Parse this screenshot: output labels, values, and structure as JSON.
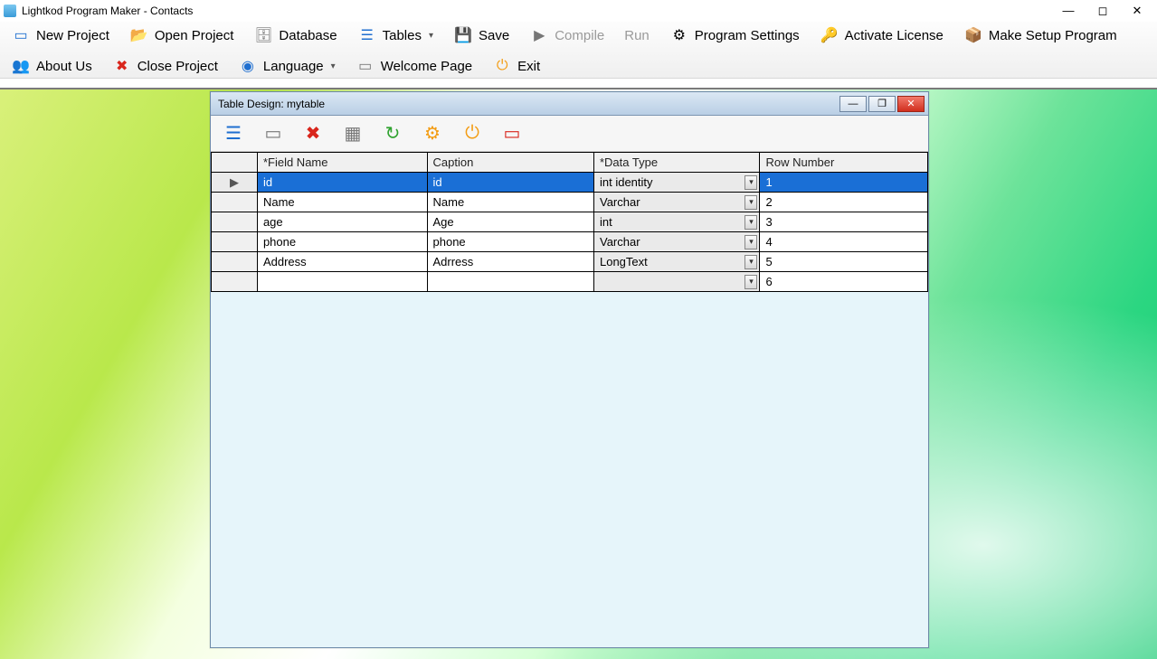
{
  "window": {
    "title": "Lightkod Program Maker - Contacts"
  },
  "toolbar": {
    "row1": [
      {
        "id": "new-project",
        "label": "New Project"
      },
      {
        "id": "open-project",
        "label": "Open Project"
      },
      {
        "id": "database",
        "label": "Database"
      },
      {
        "id": "tables",
        "label": "Tables",
        "dropdown": true
      },
      {
        "id": "save",
        "label": "Save"
      },
      {
        "id": "compile",
        "label": "Compile",
        "disabled": true
      },
      {
        "id": "run",
        "label": "Run",
        "disabled": true
      },
      {
        "id": "program-settings",
        "label": "Program Settings"
      },
      {
        "id": "activate-license",
        "label": "Activate License"
      },
      {
        "id": "make-setup",
        "label": "Make Setup Program"
      }
    ],
    "row2": [
      {
        "id": "about-us",
        "label": "About Us"
      },
      {
        "id": "close-project",
        "label": "Close Project"
      },
      {
        "id": "language",
        "label": "Language",
        "dropdown": true
      },
      {
        "id": "welcome-page",
        "label": "Welcome Page"
      },
      {
        "id": "exit",
        "label": "Exit"
      }
    ]
  },
  "child": {
    "title": "Table Design: mytable",
    "columns": [
      "*Field Name",
      "Caption",
      "*Data Type",
      "Row Number"
    ],
    "rows": [
      {
        "marker": "▶",
        "field": "id",
        "caption": "id",
        "dtype": "int identity",
        "rownum": "1",
        "selected": true
      },
      {
        "marker": "",
        "field": "Name",
        "caption": "Name",
        "dtype": "Varchar",
        "rownum": "2"
      },
      {
        "marker": "",
        "field": "age",
        "caption": "Age",
        "dtype": "int",
        "rownum": "3"
      },
      {
        "marker": "",
        "field": "phone",
        "caption": "phone",
        "dtype": "Varchar",
        "rownum": "4"
      },
      {
        "marker": "",
        "field": "Address",
        "caption": "Adrress",
        "dtype": "LongText",
        "rownum": "5"
      },
      {
        "marker": "",
        "field": "",
        "caption": "",
        "dtype": "",
        "rownum": "6"
      }
    ]
  }
}
